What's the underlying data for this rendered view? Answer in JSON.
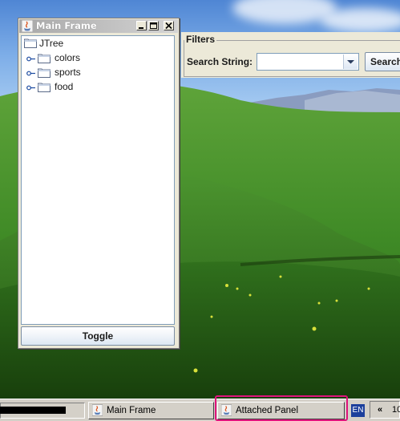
{
  "main_frame": {
    "title": "Main Frame",
    "tree": {
      "root": "JTree",
      "children": [
        "colors",
        "sports",
        "food"
      ]
    },
    "toggle_label": "Toggle"
  },
  "filters": {
    "legend": "Filters",
    "search_label": "Search String:",
    "search_value": "",
    "search_button": "Search"
  },
  "taskbar": {
    "tasks": [
      {
        "label": "Main Frame",
        "icon": "java-icon"
      },
      {
        "label": "Attached Panel",
        "icon": "java-icon",
        "highlighted": true
      }
    ],
    "language": "EN",
    "tray_chevron": "«",
    "clock": "10"
  },
  "colors": {
    "highlight": "#e0147c",
    "taskbar": "#d4d0c8",
    "window_bg": "#ece9d8"
  }
}
